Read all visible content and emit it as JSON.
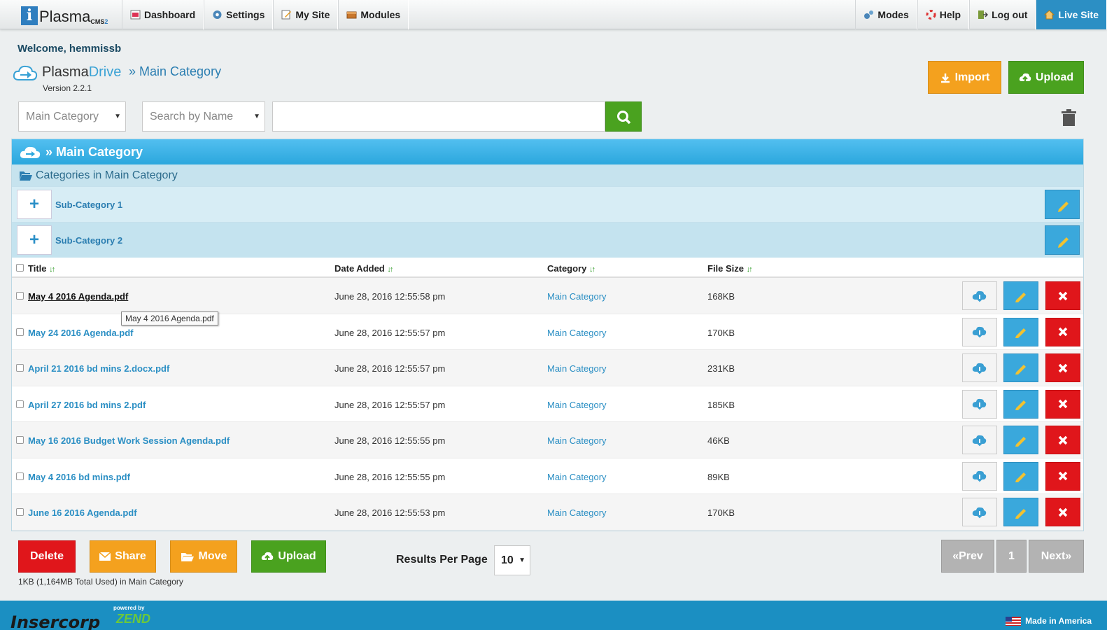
{
  "topnav": {
    "brand": "Plasma",
    "brand_sup": "CMS",
    "brand_sup_num": "2",
    "left": [
      {
        "label": "Dashboard",
        "icon": "dashboard-icon"
      },
      {
        "label": "Settings",
        "icon": "gear-icon"
      },
      {
        "label": "My Site",
        "icon": "pencil-icon"
      },
      {
        "label": "Modules",
        "icon": "modules-icon"
      }
    ],
    "right": [
      {
        "label": "Modes",
        "icon": "gears-icon"
      },
      {
        "label": "Help",
        "icon": "lifebuoy-icon"
      },
      {
        "label": "Log out",
        "icon": "logout-icon"
      },
      {
        "label": "Live Site",
        "icon": "home-icon"
      }
    ]
  },
  "header": {
    "welcome": "Welcome, hemmissb",
    "app_name_a": "Plasma",
    "app_name_b": "Drive",
    "breadcrumb": "» Main Category",
    "version": "Version 2.2.1",
    "import_label": "Import",
    "upload_label": "Upload"
  },
  "search": {
    "category_select": "Main Category",
    "field_select": "Search by Name",
    "query": ""
  },
  "panel": {
    "title": "» Main Category",
    "categories_heading": "Categories in Main Category",
    "subcategories": [
      "Sub-Category 1",
      "Sub-Category 2"
    ],
    "columns": {
      "title": "Title",
      "date": "Date Added",
      "category": "Category",
      "size": "File Size"
    },
    "files": [
      {
        "title": "May 4 2016 Agenda.pdf",
        "date": "June 28, 2016 12:55:58 pm",
        "category": "Main Category",
        "size": "168KB"
      },
      {
        "title": "May 24 2016 Agenda.pdf",
        "date": "June 28, 2016 12:55:57 pm",
        "category": "Main Category",
        "size": "170KB"
      },
      {
        "title": "April 21 2016 bd mins 2.docx.pdf",
        "date": "June 28, 2016 12:55:57 pm",
        "category": "Main Category",
        "size": "231KB"
      },
      {
        "title": "April 27 2016 bd mins 2.pdf",
        "date": "June 28, 2016 12:55:57 pm",
        "category": "Main Category",
        "size": "185KB"
      },
      {
        "title": "May 16 2016 Budget Work Session Agenda.pdf",
        "date": "June 28, 2016 12:55:55 pm",
        "category": "Main Category",
        "size": "46KB"
      },
      {
        "title": "May 4 2016 bd mins.pdf",
        "date": "June 28, 2016 12:55:55 pm",
        "category": "Main Category",
        "size": "89KB"
      },
      {
        "title": "June 16 2016 Agenda.pdf",
        "date": "June 28, 2016 12:55:53 pm",
        "category": "Main Category",
        "size": "170KB"
      }
    ],
    "tooltip": "May 4 2016 Agenda.pdf"
  },
  "bottom": {
    "delete_label": "Delete",
    "share_label": "Share",
    "move_label": "Move",
    "upload_label": "Upload",
    "rpp_label": "Results Per Page",
    "rpp_value": "10",
    "prev_label": "«Prev",
    "page_label": "1",
    "next_label": "Next»",
    "usage": "1KB (1,164MB Total Used) in Main Category"
  },
  "footer": {
    "brand": "Insercorp",
    "powered": "powered by",
    "zend": "ZEND",
    "made": "Made in America"
  },
  "colors": {
    "accent": "#2ba7dd",
    "orange": "#f4a11e",
    "green": "#4aa21f",
    "red": "#e0161b"
  }
}
